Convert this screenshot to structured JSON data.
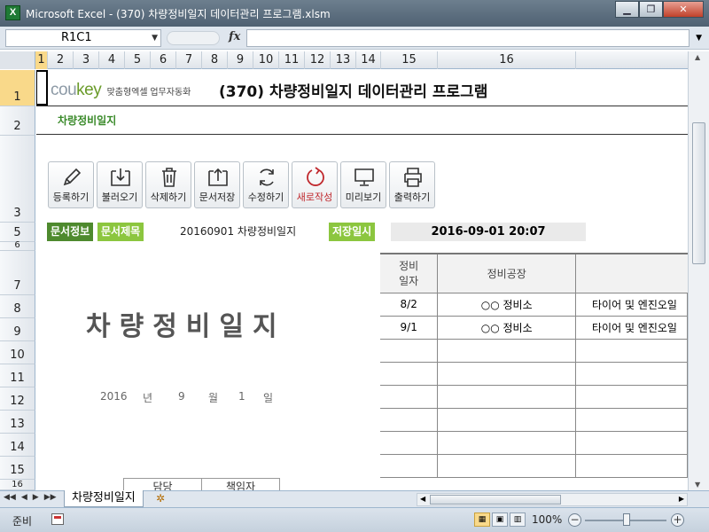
{
  "window": {
    "title": "Microsoft Excel - (370) 차량정비일지 데이터관리 프로그램.xlsm",
    "app_icon": "X",
    "min_label": "▁",
    "max_label": "❐",
    "close_label": "✕"
  },
  "formula_bar": {
    "name_box": "R1C1",
    "fx_label": "fx",
    "formula": ""
  },
  "columns": [
    "1",
    "2",
    "3",
    "4",
    "5",
    "6",
    "7",
    "8",
    "9",
    "10",
    "11",
    "12",
    "13",
    "14",
    "15",
    "16"
  ],
  "rows": [
    "1",
    "2",
    "3",
    "5",
    "6",
    "7",
    "8",
    "9",
    "10",
    "11",
    "12",
    "13",
    "14",
    "15",
    "16"
  ],
  "header": {
    "brand_cou": "cou",
    "brand_key": "key",
    "tagline": "맞춤형엑셀 업무자동화",
    "title": "(370) 차량정비일지 데이터관리 프로그램",
    "subtitle": "차량정비일지"
  },
  "toolbar": {
    "buttons": [
      {
        "label": "등록하기",
        "icon": "pencil-icon"
      },
      {
        "label": "불러오기",
        "icon": "tray-in-icon"
      },
      {
        "label": "삭제하기",
        "icon": "trash-icon"
      },
      {
        "label": "문서저장",
        "icon": "tray-out-icon"
      },
      {
        "label": "수정하기",
        "icon": "refresh-icon"
      },
      {
        "label": "새로작성",
        "icon": "new-cycle-icon"
      },
      {
        "label": "미리보기",
        "icon": "monitor-icon"
      },
      {
        "label": "출력하기",
        "icon": "printer-icon"
      }
    ]
  },
  "info": {
    "doc_info_label": "문서정보",
    "doc_title_label": "문서제목",
    "doc_title_value": "20160901 차량정비일지",
    "saved_label": "저장일시",
    "saved_value": "2016-09-01 20:07"
  },
  "form": {
    "big_title": "차량정비일지",
    "date": {
      "year": "2016",
      "year_unit": "년",
      "month": "9",
      "month_unit": "월",
      "day": "1",
      "day_unit": "일"
    },
    "approval": [
      "담당",
      "책임자"
    ]
  },
  "table": {
    "headers": [
      "정비\n일자",
      "정비공장",
      ""
    ],
    "rows": [
      [
        "8/2",
        "○○ 정비소",
        "타이어 및 엔진오일"
      ],
      [
        "9/1",
        "○○ 정비소",
        "타이어 및 엔진오일"
      ],
      [
        "",
        "",
        ""
      ],
      [
        "",
        "",
        ""
      ],
      [
        "",
        "",
        ""
      ],
      [
        "",
        "",
        ""
      ],
      [
        "",
        "",
        ""
      ],
      [
        "",
        "",
        ""
      ]
    ]
  },
  "sheet_tab": "차량정비일지",
  "status": {
    "ready": "준비",
    "zoom": "100%"
  }
}
